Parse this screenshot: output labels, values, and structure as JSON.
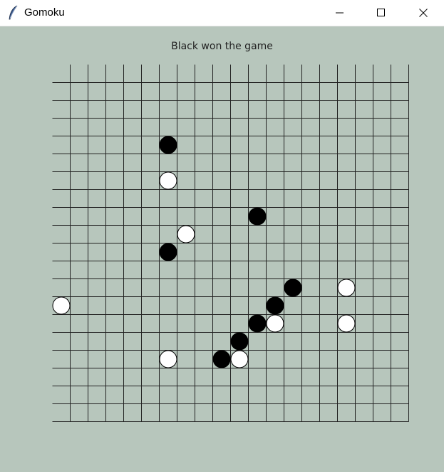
{
  "window": {
    "title": "Gomoku",
    "app_icon": "feather-icon",
    "controls": [
      "minimize-icon",
      "maximize-icon",
      "close-icon"
    ]
  },
  "status": {
    "message": "Black won the game"
  },
  "board": {
    "columns": 20,
    "rows": 20,
    "grid_color": "#222222",
    "background": "#b7c6bc",
    "black_color": "#000000",
    "white_color": "#ffffff",
    "stones": [
      {
        "color": "black",
        "col": 6,
        "row": 4
      },
      {
        "color": "white",
        "col": 6,
        "row": 6
      },
      {
        "color": "black",
        "col": 11,
        "row": 8
      },
      {
        "color": "white",
        "col": 7,
        "row": 9
      },
      {
        "color": "black",
        "col": 6,
        "row": 10
      },
      {
        "color": "black",
        "col": 13,
        "row": 12
      },
      {
        "color": "white",
        "col": 16,
        "row": 12
      },
      {
        "color": "white",
        "col": 0,
        "row": 13
      },
      {
        "color": "black",
        "col": 12,
        "row": 13
      },
      {
        "color": "black",
        "col": 11,
        "row": 14
      },
      {
        "color": "white",
        "col": 12,
        "row": 14
      },
      {
        "color": "white",
        "col": 16,
        "row": 14
      },
      {
        "color": "black",
        "col": 10,
        "row": 15
      },
      {
        "color": "white",
        "col": 6,
        "row": 16
      },
      {
        "color": "black",
        "col": 9,
        "row": 16
      },
      {
        "color": "white",
        "col": 10,
        "row": 16
      }
    ]
  }
}
